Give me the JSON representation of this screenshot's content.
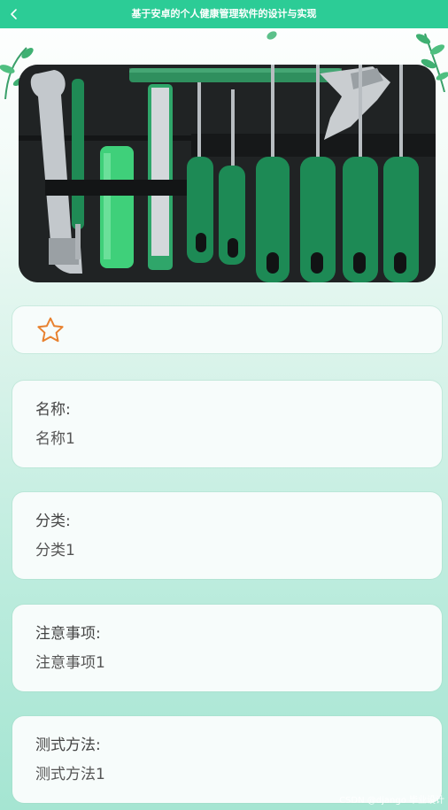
{
  "header": {
    "title": "基于安卓的个人健康管理软件的设计与实现",
    "back_icon": "chevron-left-icon",
    "background": "#2ccc96"
  },
  "banner": {
    "description_icon": "tool-kit-photo"
  },
  "favorite": {
    "icon": "star-outline-icon",
    "color": "#e8812f"
  },
  "fields": [
    {
      "label": "名称:",
      "value": "名称1"
    },
    {
      "label": "分类:",
      "value": "分类1"
    },
    {
      "label": "注意事项:",
      "value": "注意事项1"
    },
    {
      "label": "测式方法:",
      "value": "测式方法1"
    }
  ],
  "watermark": "CSDN @django 毕业设计"
}
